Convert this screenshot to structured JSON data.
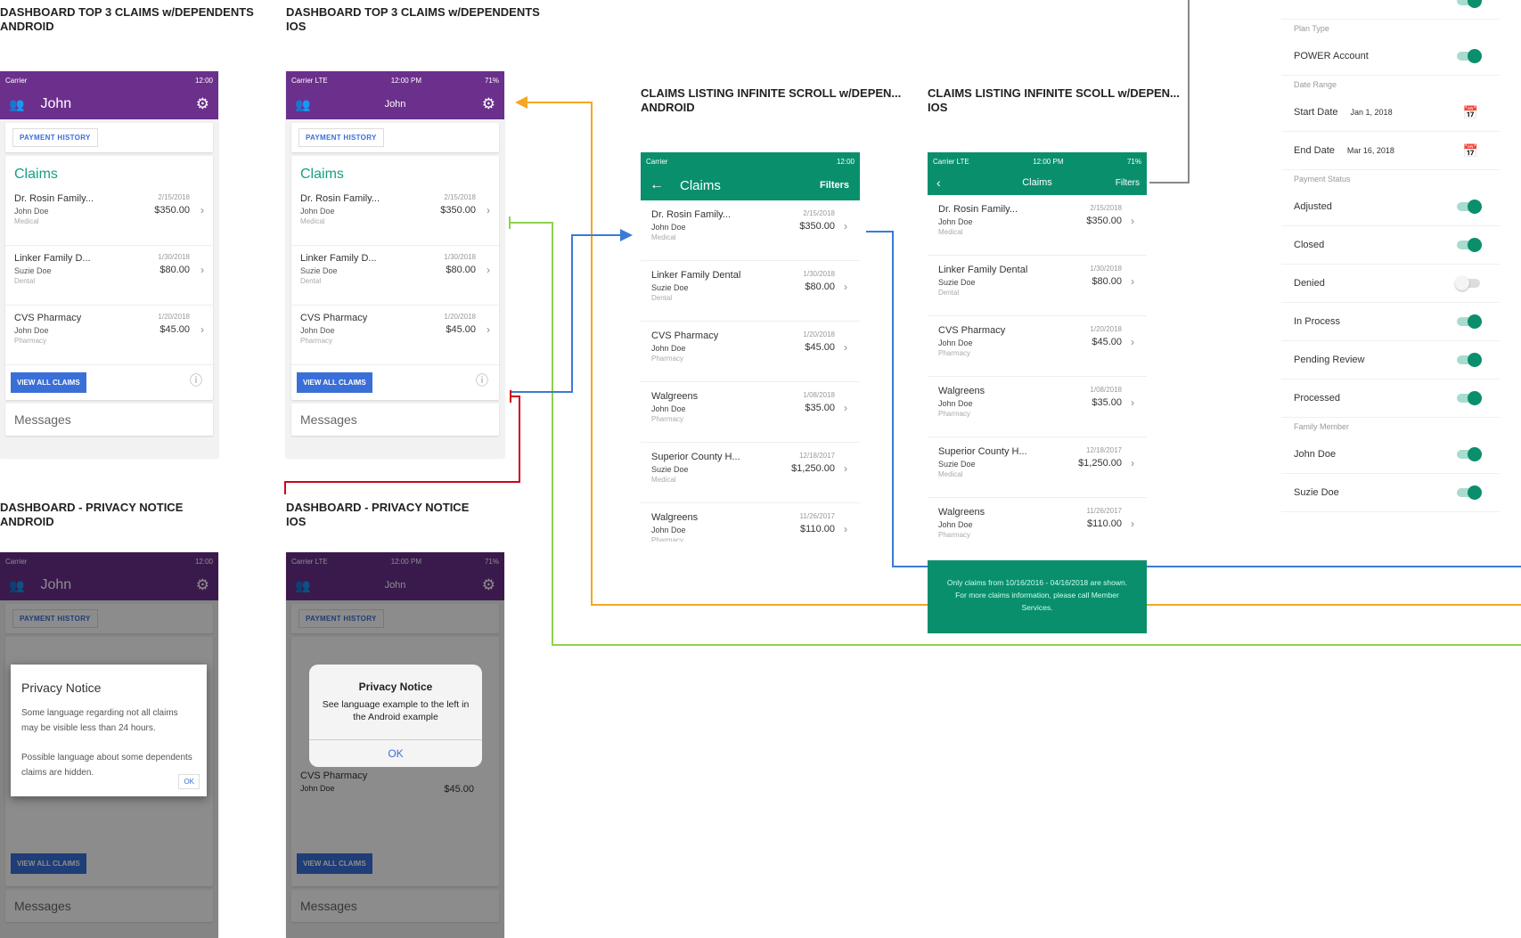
{
  "headings": {
    "dash_android": [
      "DASHBOARD TOP 3 CLAIMS w/DEPENDENTS",
      "ANDROID"
    ],
    "dash_ios": [
      "DASHBOARD TOP 3 CLAIMS w/DEPENDENTS",
      "IOS"
    ],
    "list_android": [
      "CLAIMS LISTING INFINITE SCROLL w/DEPEN...",
      "ANDROID"
    ],
    "list_ios": [
      "CLAIMS LISTING INFINITE SCOLL w/DEPEN...",
      "IOS"
    ],
    "privacy_android": [
      "DASHBOARD - PRIVACY NOTICE",
      "ANDROID"
    ],
    "privacy_ios": [
      "DASHBOARD - PRIVACY NOTICE",
      "IOS"
    ]
  },
  "status_android": {
    "carrier": "Carrier",
    "time": "12:00"
  },
  "status_ios": {
    "carrier": "Carrier LTE",
    "time": "12:00 PM",
    "battery": "71%"
  },
  "dashboard": {
    "user": "John",
    "payment_history": "PAYMENT HISTORY",
    "claims_title": "Claims",
    "view_all": "VIEW ALL CLAIMS",
    "messages": "Messages",
    "claims": [
      {
        "name": "Dr. Rosin Family...",
        "member": "John Doe",
        "type": "Medical",
        "date": "2/15/2018",
        "amount": "$350.00"
      },
      {
        "name": "Linker Family D...",
        "member": "Suzie Doe",
        "type": "Dental",
        "date": "1/30/2018",
        "amount": "$80.00"
      },
      {
        "name": "CVS Pharmacy",
        "member": "John Doe",
        "type": "Pharmacy",
        "date": "1/20/2018",
        "amount": "$45.00"
      }
    ]
  },
  "listing": {
    "title": "Claims",
    "filters": "Filters",
    "claims": [
      {
        "name": "Dr. Rosin Family...",
        "member": "John Doe",
        "type": "Medical",
        "date": "2/15/2018",
        "amount": "$350.00"
      },
      {
        "name": "Linker Family Dental",
        "member": "Suzie Doe",
        "type": "Dental",
        "date": "1/30/2018",
        "amount": "$80.00"
      },
      {
        "name": "CVS Pharmacy",
        "member": "John Doe",
        "type": "Pharmacy",
        "date": "1/20/2018",
        "amount": "$45.00"
      },
      {
        "name": "Walgreens",
        "member": "John Doe",
        "type": "Pharmacy",
        "date": "1/08/2018",
        "amount": "$35.00"
      },
      {
        "name": "Superior County H...",
        "member": "Suzie Doe",
        "type": "Medical",
        "date": "12/18/2017",
        "amount": "$1,250.00"
      },
      {
        "name": "Walgreens",
        "member": "John Doe",
        "type": "Pharmacy",
        "date": "11/26/2017",
        "amount": "$110.00"
      }
    ],
    "disclaimer": "Only claims from 10/16/2016 - 04/16/2018 are shown. For more claims information, please call Member Services."
  },
  "filters": {
    "plan_type_label": "Plan Type",
    "power_account": "POWER Account",
    "date_range_label": "Date Range",
    "start_date_label": "Start Date",
    "start_date": "Jan 1, 2018",
    "end_date_label": "End Date",
    "end_date": "Mar 16, 2018",
    "payment_status_label": "Payment Status",
    "statuses": [
      {
        "label": "Adjusted",
        "on": true
      },
      {
        "label": "Closed",
        "on": true
      },
      {
        "label": "Denied",
        "on": false
      },
      {
        "label": "In Process",
        "on": true
      },
      {
        "label": "Pending Review",
        "on": true
      },
      {
        "label": "Processed",
        "on": true
      }
    ],
    "family_member_label": "Family Member",
    "members": [
      {
        "label": "John Doe",
        "on": true
      },
      {
        "label": "Suzie Doe",
        "on": true
      }
    ]
  },
  "privacy": {
    "android_title": "Privacy Notice",
    "android_body_1": "Some language regarding not all claims may be visible less than 24 hours.",
    "android_body_2": "Possible language about some dependents claims are hidden.",
    "android_ok": "OK",
    "ios_title": "Privacy Notice",
    "ios_body": "See language example to the left in the Android example",
    "ios_ok": "OK"
  },
  "colors": {
    "purple": "#6b2f8c",
    "green": "#0a8f6c",
    "orange": "#f5a623",
    "blue": "#3a7bd5",
    "red": "#d0021b",
    "lime": "#8fd14f"
  }
}
